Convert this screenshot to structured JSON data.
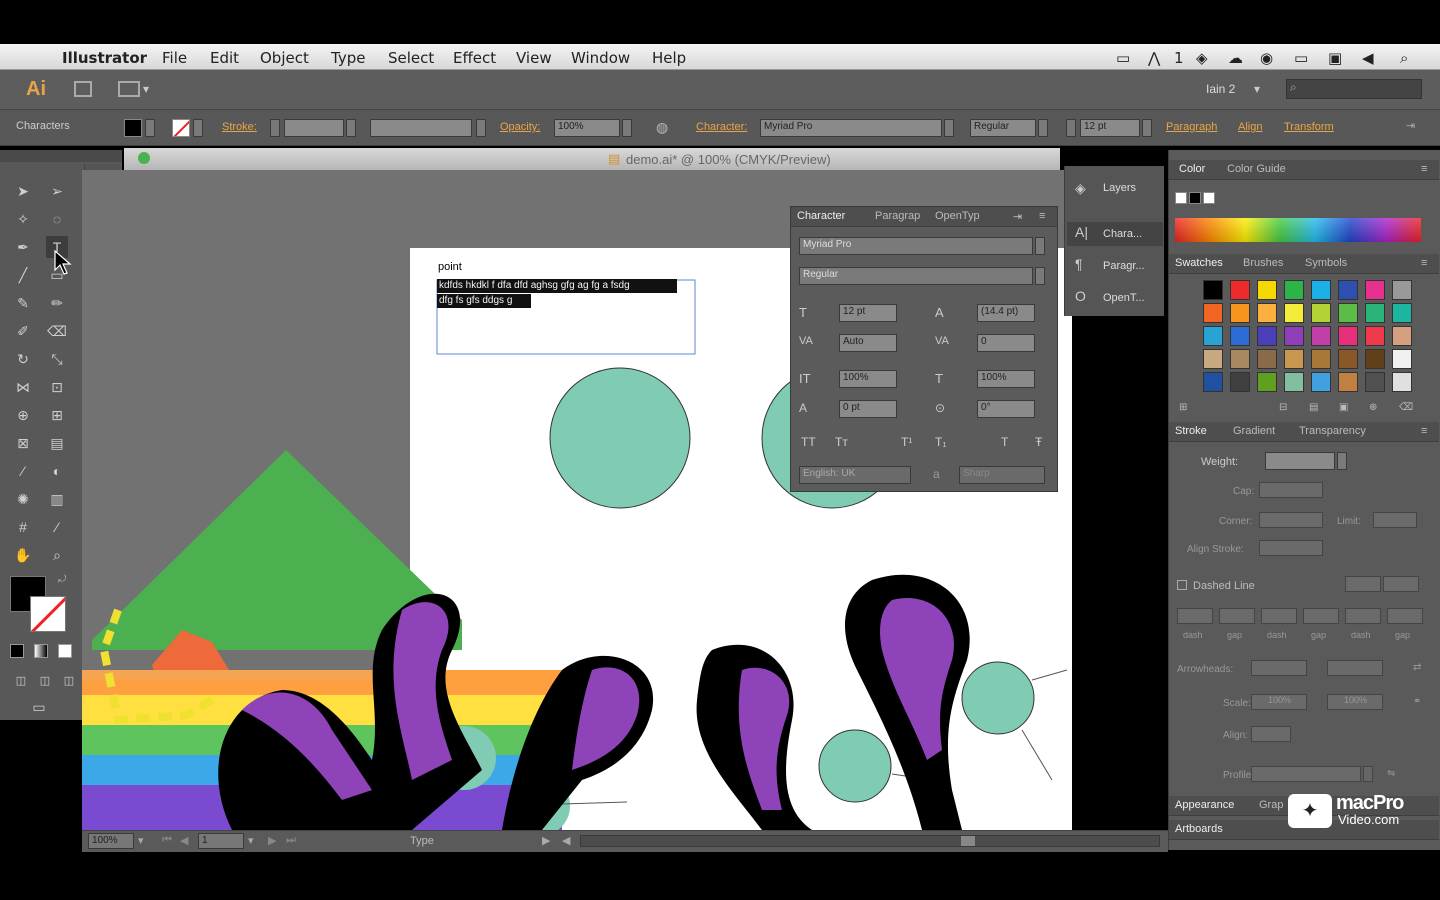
{
  "menubar": {
    "app_name": "Illustrator",
    "items": [
      "File",
      "Edit",
      "Object",
      "Type",
      "Select",
      "Effect",
      "View",
      "Window",
      "Help"
    ],
    "status_items": [
      "1"
    ]
  },
  "appbar": {
    "logo": "Ai",
    "workspace": "Iain 2",
    "search_placeholder": ""
  },
  "control": {
    "label": "Characters",
    "stroke_label": "Stroke:",
    "opacity_label": "Opacity:",
    "opacity_value": "100%",
    "character_label": "Character:",
    "font_family": "Myriad Pro",
    "font_style": "Regular",
    "font_size": "12 pt",
    "paragraph_link": "Paragraph",
    "align_link": "Align",
    "transform_link": "Transform"
  },
  "document": {
    "tab_title": "demo.ai* @ 100% (CMYK/Preview)",
    "point_label": "point",
    "text_line1": "kdfds hkdkl f dfa dfd aghsg gfg ag fg a fsdg",
    "text_line2": "dfg fs gfs ddgs g"
  },
  "status": {
    "zoom": "100%",
    "page": "1",
    "tool": "Type"
  },
  "character_panel": {
    "tabs": [
      "Character",
      "Paragrap",
      "OpenTyp"
    ],
    "font_family": "Myriad Pro",
    "font_style": "Regular",
    "size": "12 pt",
    "leading": "(14.4 pt)",
    "kerning": "Auto",
    "tracking": "0",
    "vscale": "100%",
    "hscale": "100%",
    "baseline": "0 pt",
    "rotation": "0°",
    "language": "English: UK",
    "aa": "Sharp"
  },
  "docked": {
    "items": [
      "Layers",
      "Chara...",
      "Paragr...",
      "OpenT..."
    ]
  },
  "color_panel": {
    "tabs": [
      "Color",
      "Color Guide"
    ]
  },
  "swatches_panel": {
    "tabs": [
      "Swatches",
      "Brushes",
      "Symbols"
    ],
    "colors": [
      "#000000",
      "#ee2a2a",
      "#f5d800",
      "#2db34a",
      "#1ab0e8",
      "#2d50b0",
      "#e8308e",
      "#999999",
      "#f26522",
      "#f7941d",
      "#fbaf3f",
      "#f5eb3b",
      "#b2d235",
      "#5bbd45",
      "#2ab47a",
      "#1cb5a0",
      "#29a3d4",
      "#2d6bd4",
      "#4a3fb8",
      "#8e3fb8",
      "#c23fa8",
      "#e8307a",
      "#ee3a4a",
      "#d4a080",
      "#c8a880",
      "#a88860",
      "#8a6a48",
      "#c89850",
      "#a87838",
      "#885828",
      "#604018",
      "#f0f0f0",
      "#2050a0",
      "#404040",
      "#60a020",
      "#80c0a0",
      "#40a0e0",
      "#c08040",
      "#505050",
      "#e0e0e0"
    ]
  },
  "stroke_panel": {
    "tabs": [
      "Stroke",
      "Gradient",
      "Transparency"
    ],
    "weight_label": "Weight:",
    "cap_label": "Cap:",
    "corner_label": "Corner:",
    "limit_label": "Limit:",
    "align_label": "Align Stroke:",
    "dashed_label": "Dashed Line",
    "dash_labels": [
      "dash",
      "gap",
      "dash",
      "gap",
      "dash",
      "gap"
    ],
    "arrowheads_label": "Arrowheads:",
    "scale_label": "Scale:",
    "scale_value": "100%",
    "align2_label": "Align:",
    "profile_label": "Profile:"
  },
  "bottom_panels": {
    "appearance": "Appearance",
    "graphic": "Grap",
    "artboards": "Artboards"
  },
  "watermark": {
    "line1": "macPro",
    "line2": "Video.com"
  },
  "colors": {
    "accent": "#e8a548",
    "panel_bg": "#5b5b5b",
    "canvas_bg": "#727272",
    "circle_fill": "#7fcbb4",
    "purple": "#8e44b8",
    "green": "#4caf50"
  }
}
